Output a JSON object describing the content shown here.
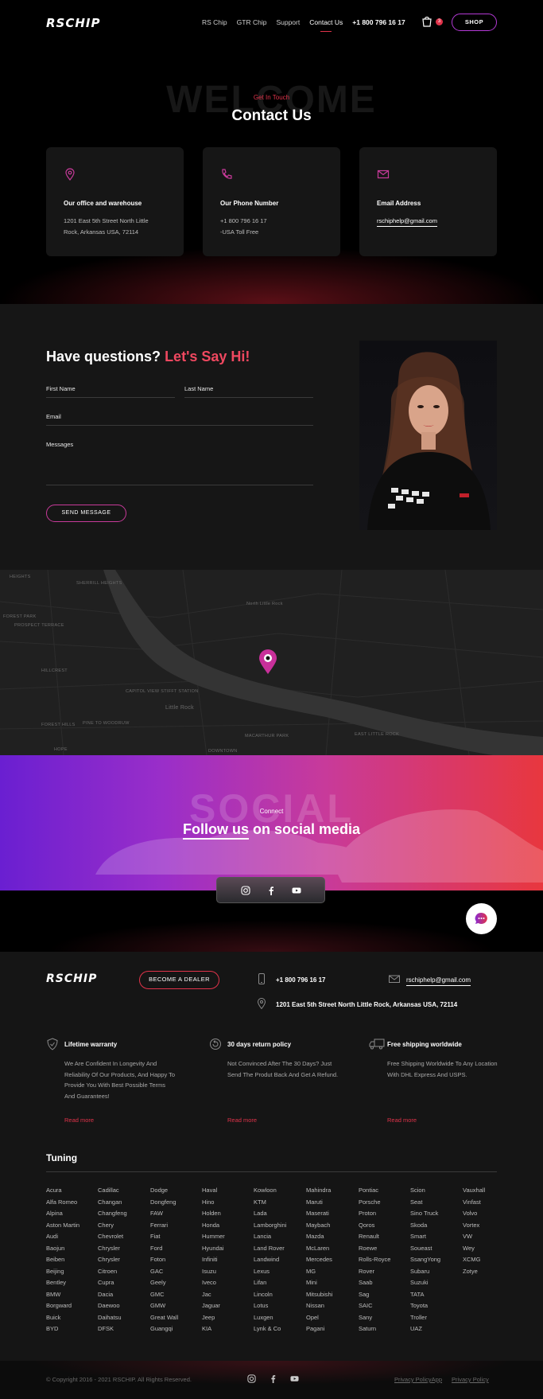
{
  "header": {
    "logo": "RSCHIP",
    "nav": [
      "RS Chip",
      "GTR Chip",
      "Support",
      "Contact Us"
    ],
    "phone": "+1 800 796 16 17",
    "cart_count": "3",
    "shop_label": "SHOP"
  },
  "hero": {
    "watermark": "WELCOME",
    "kicker": "Get In Touch",
    "title": "Contact Us"
  },
  "cards": [
    {
      "icon": "location-pin-icon",
      "title": "Our office and warehouse",
      "line1": "1201 East 5th Street North Little",
      "line2": "Rock, Arkansas USA, 72114"
    },
    {
      "icon": "phone-icon",
      "title": "Our Phone Number",
      "line1": "+1 800 796 16 17",
      "line2": "-USA Toll Free"
    },
    {
      "icon": "mail-icon",
      "title": "Email Address",
      "line1": "rschiphelp@gmail.com"
    }
  ],
  "form": {
    "heading": "Have questions?",
    "heading_accent": "Let's Say Hi!",
    "first_name": "First Name",
    "last_name": "Last Name",
    "email": "Email",
    "messages": "Messages",
    "send_label": "SEND MESSAGE"
  },
  "map": {
    "labels": [
      "HEIGHTS",
      "SHERRILL HEIGHTS",
      "North Little Rock",
      "FOREST PARK",
      "PROSPECT TERRACE",
      "HILLCREST",
      "CAPITOL VIEW STIFFT STATION",
      "Little Rock",
      "FOREST HILLS",
      "PINE TO WOODRUW",
      "MACARTHUR PARK",
      "EAST LITTLE ROCK",
      "HOPE",
      "DOWNTOWN"
    ]
  },
  "social": {
    "watermark": "SOCIAL",
    "kicker": "Connect",
    "title_underlined": "Follow us",
    "title_rest": " on social media",
    "icons": [
      "instagram-icon",
      "facebook-icon",
      "youtube-icon"
    ]
  },
  "footer": {
    "logo": "RSCHIP",
    "dealer_label": "BECOME A DEALER",
    "phone": "+1 800 796 16 17",
    "email": "rschiphelp@gmail.com",
    "address": "1201 East 5th Street North Little Rock, Arkansas USA, 72114",
    "features": [
      {
        "title": "Lifetime warranty",
        "desc": "We Are Confident In Longevity And Reliability Of Our Products, And Happy To Provide You With Best Possible Terms And Guarantees!",
        "link": "Read more"
      },
      {
        "title": "30 days return policy",
        "desc": "Not Convinced After The 30 Days? Just Send The Produt Back And Get A Refund.",
        "link": "Read more"
      },
      {
        "title": "Free shipping worldwide",
        "desc": "Free Shipping Worldwide To Any Location With DHL Express And USPS.",
        "link": "Read more"
      }
    ],
    "tuning_title": "Tuning",
    "brands": [
      [
        "Acura",
        "Alfa Romeo",
        "Alpina",
        "Aston Martin",
        "Audi",
        "Baojun",
        "Beiben",
        "Beijing",
        "Bentley",
        "BMW",
        "Borgward",
        "Buick",
        "BYD"
      ],
      [
        "Cadillac",
        "Changan",
        "Changfeng",
        "Chery",
        "Chevrolet",
        "Chrysler",
        "Chrysler",
        "Citroen",
        "Cupra",
        "Dacia",
        "Daewoo",
        "Daihatsu",
        "DFSK"
      ],
      [
        "Dodge",
        "Dongfeng",
        "FAW",
        "Ferrari",
        "Fiat",
        "Ford",
        "Foton",
        "GAC",
        "Geely",
        "GMC",
        "GMW",
        "Great Wall",
        "Guangqi"
      ],
      [
        "Haval",
        "Hino",
        "Holden",
        "Honda",
        "Hummer",
        "Hyundai",
        "Infiniti",
        "Isuzu",
        "Iveco",
        "Jac",
        "Jaguar",
        "Jeep",
        "KIA"
      ],
      [
        "Kowloon",
        "KTM",
        "Lada",
        "Lamborghini",
        "Lancia",
        "Land Rover",
        "Landwind",
        "Lexus",
        "Lifan",
        "Lincoln",
        "Lotus",
        "Luxgen",
        "Lynk & Co"
      ],
      [
        "Mahindra",
        "Maruti",
        "Maserati",
        "Maybach",
        "Mazda",
        "McLaren",
        "Mercedes",
        "MG",
        "Mini",
        "Mitsubishi",
        "Nissan",
        "Opel",
        "Pagani"
      ],
      [
        "Pontiac",
        "Porsche",
        "Proton",
        "Qoros",
        "Renault",
        "Roewe",
        "Rolls-Royce",
        "Rover",
        "Saab",
        "Sag",
        "SAIC",
        "Sany",
        "Saturn"
      ],
      [
        "Scion",
        "Seat",
        "Sino Truck",
        "Skoda",
        "Smart",
        "Soueast",
        "SsangYong",
        "Subaru",
        "Suzuki",
        "TATA",
        "Toyota",
        "Troller",
        "UAZ"
      ],
      [
        "Vauxhall",
        "Vinfast",
        "Volvo",
        "Vortex",
        "VW",
        "Wey",
        "XCMG",
        "Zotye"
      ]
    ],
    "copyright": "© Copyright 2016 - 2021 RSCHIP. All Rights Reserved.",
    "privacy_policy": "Privacy PolicyApp",
    "privacy_policy_2": "Privacy Policy"
  },
  "colors": {
    "accent": "#e0334a",
    "purple": "#b43ad6",
    "gradient_start": "#6a1fd1",
    "gradient_end": "#e8373e"
  }
}
